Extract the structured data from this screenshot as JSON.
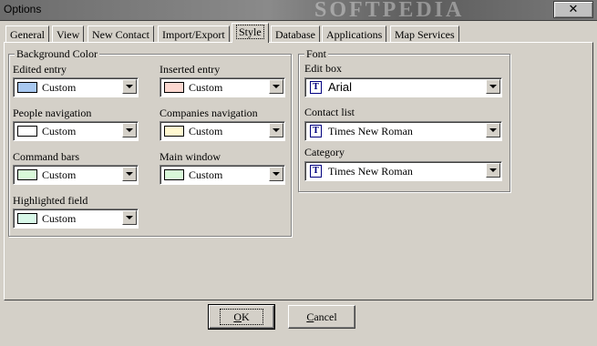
{
  "window": {
    "title": "Options",
    "close_glyph": "✕",
    "watermark": "SOFTPEDIA"
  },
  "tabs": [
    {
      "label": "General"
    },
    {
      "label": "View"
    },
    {
      "label": "New Contact"
    },
    {
      "label": "Import/Export"
    },
    {
      "label": "Style",
      "active": true
    },
    {
      "label": "Database"
    },
    {
      "label": "Applications"
    },
    {
      "label": "Map Services"
    }
  ],
  "background_color": {
    "title": "Background Color",
    "fields": [
      {
        "label": "Edited entry",
        "value": "Custom",
        "swatch": "#a8c8f0"
      },
      {
        "label": "Inserted entry",
        "value": "Custom",
        "swatch": "#fcd8d0"
      },
      {
        "label": "People navigation",
        "value": "Custom",
        "swatch": "#ffffff"
      },
      {
        "label": "Companies navigation",
        "value": "Custom",
        "swatch": "#fff8d0"
      },
      {
        "label": "Command bars",
        "value": "Custom",
        "swatch": "#d8f8d8"
      },
      {
        "label": "Main window",
        "value": "Custom",
        "swatch": "#d8f8d8"
      },
      {
        "label": "Highlighted field",
        "value": "Custom",
        "swatch": "#d8f8e8"
      }
    ]
  },
  "font": {
    "title": "Font",
    "fields": [
      {
        "label": "Edit box",
        "value": "Arial",
        "icon": "font-icon",
        "glyph": "T"
      },
      {
        "label": "Contact list",
        "value": "Times New Roman",
        "icon": "font-icon",
        "glyph": "T"
      },
      {
        "label": "Category",
        "value": "Times New Roman",
        "icon": "font-icon",
        "glyph": "T"
      }
    ]
  },
  "buttons": {
    "ok": {
      "accel": "O",
      "rest": "K"
    },
    "cancel": {
      "accel": "C",
      "rest": "ancel"
    }
  }
}
